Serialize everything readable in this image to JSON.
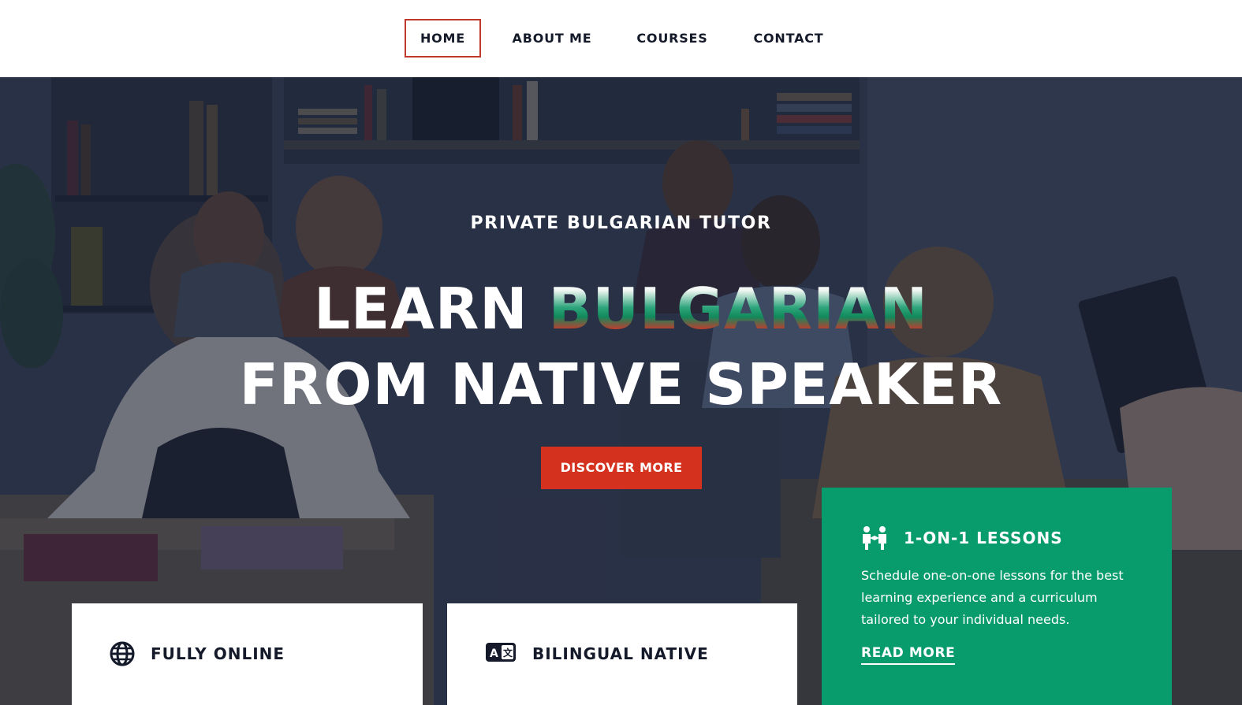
{
  "nav": {
    "items": [
      {
        "label": "HOME",
        "active": true
      },
      {
        "label": "ABOUT ME",
        "active": false
      },
      {
        "label": "COURSES",
        "active": false
      },
      {
        "label": "CONTACT",
        "active": false
      }
    ],
    "active_border_color": "#c0392b"
  },
  "hero": {
    "eyebrow": "PRIVATE BULGARIAN TUTOR",
    "headline_line1_prefix": "LEARN ",
    "headline_line1_accent": "BULGARIAN",
    "headline_line2": "FROM NATIVE SPEAKER",
    "accent_gradient": [
      "#ffffff",
      "#118a5c",
      "#d63a24"
    ],
    "cta_label": "DISCOVER MORE",
    "cta_color": "#d4321f",
    "background_image": "classroom-photo"
  },
  "cards": {
    "online": {
      "title": "FULLY ONLINE",
      "icon": "globe-icon"
    },
    "bilingual": {
      "title": "BILINGUAL NATIVE",
      "icon": "translate-icon"
    },
    "lessons": {
      "title": "1-ON-1 LESSONS",
      "icon": "people-icon",
      "text": "Schedule one-on-one lessons for the best learning experience and a curriculum tailored to your individual needs.",
      "link_label": "READ MORE",
      "color": "#089b6b"
    }
  }
}
